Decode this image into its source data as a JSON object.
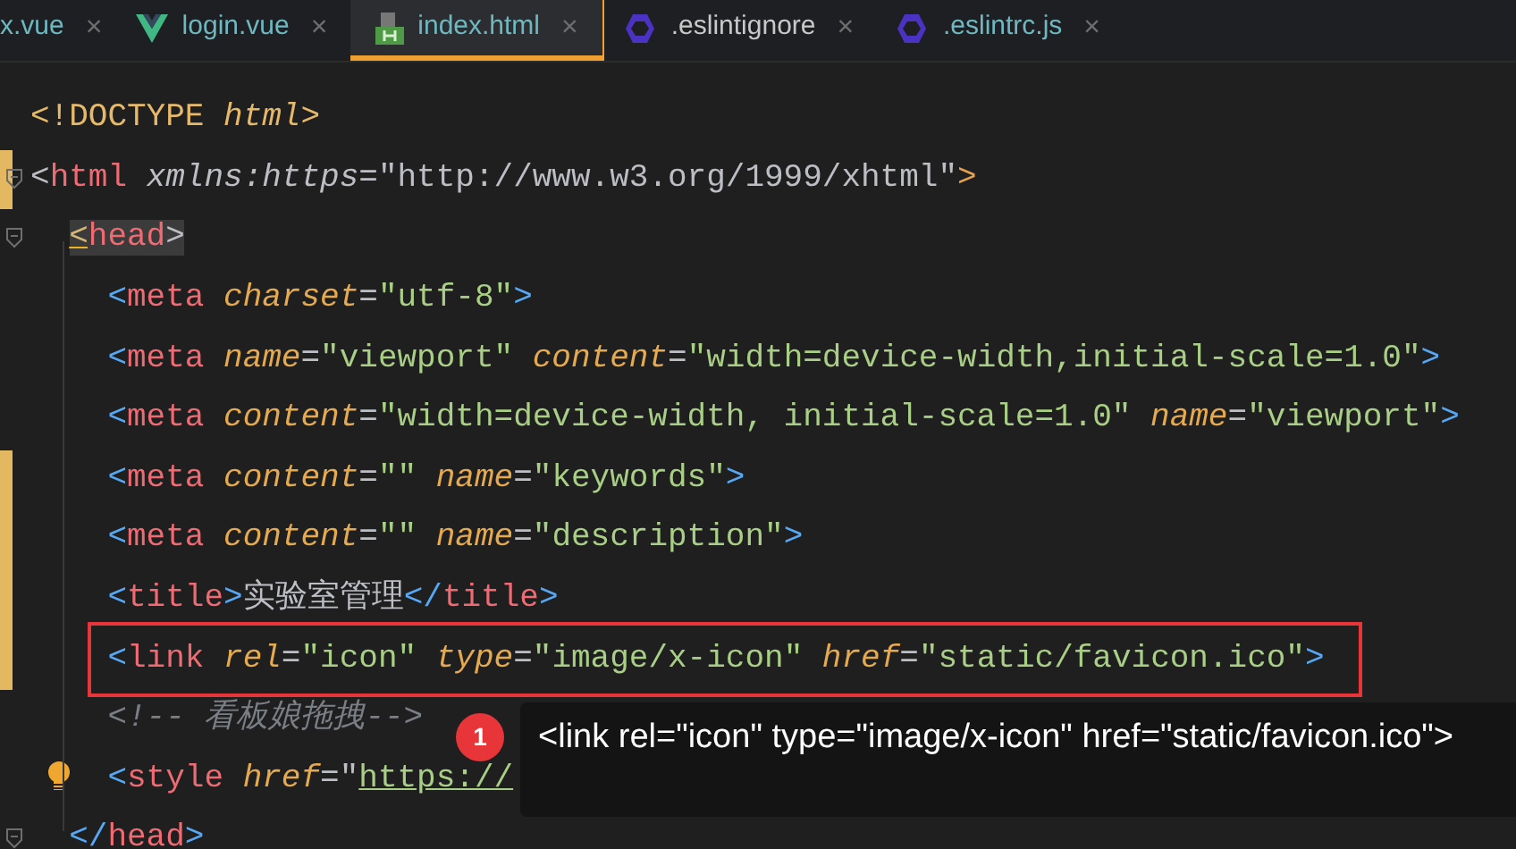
{
  "tabs": [
    {
      "label": "x.vue",
      "selected": false,
      "modified": true,
      "close": "×"
    },
    {
      "label": "login.vue",
      "kind": "vue",
      "selected": false,
      "modified": true,
      "close": "×"
    },
    {
      "label": "index.html",
      "kind": "html",
      "selected": true,
      "modified": true,
      "close": "×"
    },
    {
      "label": ".eslintignore",
      "kind": "eslint",
      "selected": false,
      "modified": false,
      "close": "×"
    },
    {
      "label": ".eslintrc.js",
      "kind": "eslint",
      "selected": false,
      "modified": true,
      "close": "×"
    }
  ],
  "editor": {
    "lines": [
      {
        "changed": false,
        "fold": false,
        "highlighted": false,
        "tokens": [
          {
            "kind": "doctype",
            "text": "<!DOCTYPE "
          },
          {
            "kind": "doctype_italic",
            "text": "html"
          },
          {
            "kind": "doctype",
            "text": ">"
          }
        ]
      },
      {
        "changed": true,
        "fold": true,
        "highlighted": false,
        "tokens": [
          {
            "kind": "plain",
            "text": "<"
          },
          {
            "kind": "tag",
            "text": "html "
          },
          {
            "kind": "ns_attr",
            "text": "xmlns:https"
          },
          {
            "kind": "plain",
            "text": "=\"http://www.w3.org/1999/xhtml\""
          },
          {
            "kind": "close_orange",
            "text": ">"
          }
        ],
        "children": [
          {
            "changed": false,
            "fold": true,
            "highlighted": false,
            "tokens": [
              {
                "kind": "matched_open",
                "text": "<"
              },
              {
                "kind": "matched_tag",
                "text": "head"
              },
              {
                "kind": "matched_close",
                "text": ">"
              }
            ],
            "children": [
              {
                "changed": false,
                "fold": false,
                "highlighted": false,
                "tokens": [
                  {
                    "kind": "bracket",
                    "text": "<"
                  },
                  {
                    "kind": "tag",
                    "text": "meta "
                  },
                  {
                    "kind": "attr",
                    "text": "charset"
                  },
                  {
                    "kind": "plain",
                    "text": "="
                  },
                  {
                    "kind": "string",
                    "text": "\"utf-8\""
                  },
                  {
                    "kind": "bracket",
                    "text": ">"
                  }
                ]
              },
              {
                "changed": false,
                "fold": false,
                "highlighted": false,
                "tokens": [
                  {
                    "kind": "bracket",
                    "text": "<"
                  },
                  {
                    "kind": "tag",
                    "text": "meta "
                  },
                  {
                    "kind": "attr",
                    "text": "name"
                  },
                  {
                    "kind": "plain",
                    "text": "="
                  },
                  {
                    "kind": "string",
                    "text": "\"viewport\" "
                  },
                  {
                    "kind": "attr",
                    "text": "content"
                  },
                  {
                    "kind": "plain",
                    "text": "="
                  },
                  {
                    "kind": "string",
                    "text": "\"width=device-width,initial-scale=1.0\""
                  },
                  {
                    "kind": "bracket",
                    "text": ">"
                  }
                ]
              },
              {
                "changed": false,
                "fold": false,
                "highlighted": false,
                "tokens": [
                  {
                    "kind": "bracket",
                    "text": "<"
                  },
                  {
                    "kind": "tag",
                    "text": "meta "
                  },
                  {
                    "kind": "attr",
                    "text": "content"
                  },
                  {
                    "kind": "plain",
                    "text": "="
                  },
                  {
                    "kind": "string",
                    "text": "\"width=device-width, initial-scale=1.0\" "
                  },
                  {
                    "kind": "attr",
                    "text": "name"
                  },
                  {
                    "kind": "plain",
                    "text": "="
                  },
                  {
                    "kind": "string",
                    "text": "\"viewport\""
                  },
                  {
                    "kind": "bracket",
                    "text": ">"
                  }
                ]
              },
              {
                "changed": true,
                "fold": false,
                "highlighted": false,
                "tokens": [
                  {
                    "kind": "bracket",
                    "text": "<"
                  },
                  {
                    "kind": "tag",
                    "text": "meta "
                  },
                  {
                    "kind": "attr",
                    "text": "content"
                  },
                  {
                    "kind": "plain",
                    "text": "="
                  },
                  {
                    "kind": "string",
                    "text": "\"\" "
                  },
                  {
                    "kind": "attr",
                    "text": "name"
                  },
                  {
                    "kind": "plain",
                    "text": "="
                  },
                  {
                    "kind": "string",
                    "text": "\"keywords\""
                  },
                  {
                    "kind": "bracket",
                    "text": ">"
                  }
                ]
              },
              {
                "changed": true,
                "fold": false,
                "highlighted": false,
                "tokens": [
                  {
                    "kind": "bracket",
                    "text": "<"
                  },
                  {
                    "kind": "tag",
                    "text": "meta "
                  },
                  {
                    "kind": "attr",
                    "text": "content"
                  },
                  {
                    "kind": "plain",
                    "text": "="
                  },
                  {
                    "kind": "string",
                    "text": "\"\" "
                  },
                  {
                    "kind": "attr",
                    "text": "name"
                  },
                  {
                    "kind": "plain",
                    "text": "="
                  },
                  {
                    "kind": "string",
                    "text": "\"description\""
                  },
                  {
                    "kind": "bracket",
                    "text": ">"
                  }
                ]
              },
              {
                "changed": true,
                "fold": false,
                "highlighted": false,
                "tokens": [
                  {
                    "kind": "bracket",
                    "text": "<"
                  },
                  {
                    "kind": "tag",
                    "text": "title"
                  },
                  {
                    "kind": "bracket",
                    "text": ">"
                  },
                  {
                    "kind": "plain",
                    "text": "实验室管理"
                  },
                  {
                    "kind": "bracket",
                    "text": "</"
                  },
                  {
                    "kind": "tag",
                    "text": "title"
                  },
                  {
                    "kind": "bracket",
                    "text": ">"
                  }
                ]
              },
              {
                "changed": true,
                "fold": false,
                "highlighted": true,
                "tokens": [
                  {
                    "kind": "bracket",
                    "text": "<"
                  },
                  {
                    "kind": "tag",
                    "text": "link "
                  },
                  {
                    "kind": "attr",
                    "text": "rel"
                  },
                  {
                    "kind": "plain",
                    "text": "="
                  },
                  {
                    "kind": "string",
                    "text": "\"icon\" "
                  },
                  {
                    "kind": "attr",
                    "text": "type"
                  },
                  {
                    "kind": "plain",
                    "text": "="
                  },
                  {
                    "kind": "string",
                    "text": "\"image/x-icon\" "
                  },
                  {
                    "kind": "attr",
                    "text": "href"
                  },
                  {
                    "kind": "plain",
                    "text": "="
                  },
                  {
                    "kind": "string",
                    "text": "\"static/favicon.ico\""
                  },
                  {
                    "kind": "bracket",
                    "text": ">"
                  }
                ]
              },
              {
                "changed": false,
                "fold": false,
                "highlighted": false,
                "tokens": [
                  {
                    "kind": "comment",
                    "text": "<!-- 看板娘拖拽-->"
                  }
                ]
              },
              {
                "changed": false,
                "fold": false,
                "highlighted": false,
                "bulb": true,
                "tokens": [
                  {
                    "kind": "bracket",
                    "text": "<"
                  },
                  {
                    "kind": "tag",
                    "text": "style "
                  },
                  {
                    "kind": "attr",
                    "text": "href"
                  },
                  {
                    "kind": "plain",
                    "text": "=\""
                  },
                  {
                    "kind": "url",
                    "text": "https://"
                  }
                ]
              }
            ]
          },
          {
            "changed": false,
            "fold": true,
            "highlighted": false,
            "tokens": [
              {
                "kind": "bracket",
                "text": "</"
              },
              {
                "kind": "tag",
                "text": "head"
              },
              {
                "kind": "bracket",
                "text": ">"
              }
            ]
          }
        ]
      }
    ],
    "tooltip": {
      "badge": "1",
      "text": "<link rel=\"icon\" type=\"image/x-icon\" href=\"static/favicon.ico\">"
    }
  }
}
